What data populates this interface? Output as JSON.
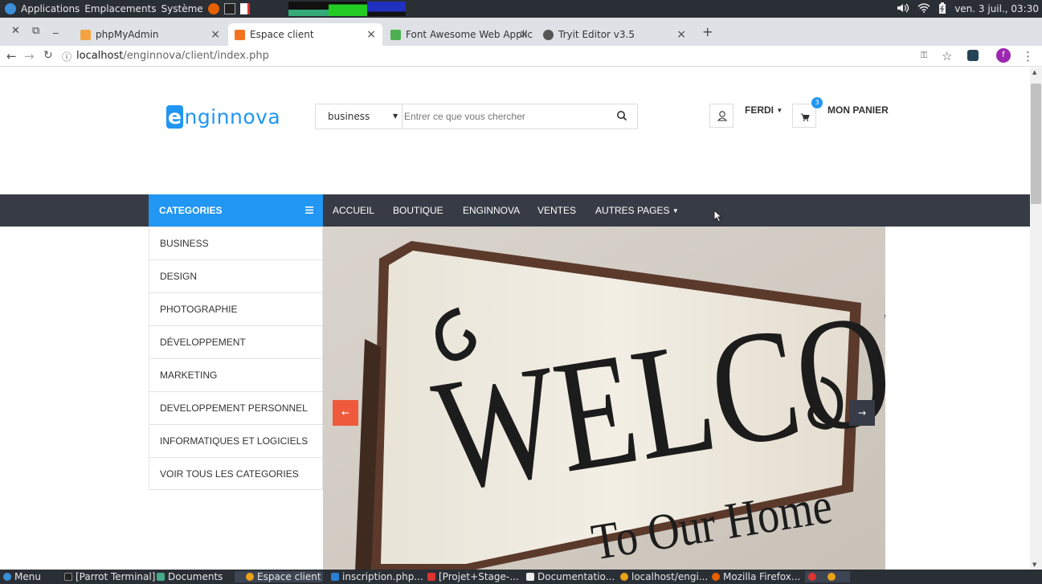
{
  "os_panel": {
    "menus": [
      "Applications",
      "Emplacements",
      "Système"
    ],
    "clock": "ven. 3 juil., 03:30"
  },
  "browser": {
    "tabs": [
      {
        "title": "phpMyAdmin",
        "active": false
      },
      {
        "title": "Espace client",
        "active": true
      },
      {
        "title": "Font Awesome Web Applic",
        "active": false
      },
      {
        "title": "Tryit Editor v3.5",
        "active": false
      }
    ],
    "url_host": "localhost",
    "url_path": "/enginnova/client/index.php",
    "profile_initial": "f"
  },
  "site": {
    "logo": {
      "first": "e",
      "rest": "nginnova"
    },
    "search": {
      "category": "business",
      "placeholder": "Entrer ce que vous chercher"
    },
    "user_label": "FERDI",
    "cart_count": "3",
    "cart_label": "MON PANIER",
    "categories_label": "CATEGORIES",
    "nav": [
      "ACCUEIL",
      "BOUTIQUE",
      "ENGINNOVA",
      "VENTES",
      "AUTRES PAGES"
    ],
    "categories": [
      "BUSINESS",
      "DESIGN",
      "PHOTOGRAPHIE",
      "DÉVELOPPEMENT",
      "MARKETING",
      "DEVELOPPEMENT PERSONNEL",
      "INFORMATIQUES ET LOGICIELS",
      "VOIR TOUS LES CATEGORIES"
    ],
    "slider": {
      "line1": "WELCOME",
      "line2": "To Our Home",
      "prev": "←",
      "next": "→"
    }
  },
  "taskbar": {
    "menu": "Menu",
    "items": [
      "[Parrot Terminal]",
      "Documents",
      "Espace client - ...",
      "inscription.php...",
      "[Projet+Stage-...",
      "Documentatio...",
      "localhost/engi...",
      "Mozilla Firefox..."
    ]
  },
  "colors": {
    "accent": "#2196f3",
    "navbar": "#363b45",
    "slider_arrow_prev": "#ee5a3b",
    "slider_arrow_next": "#363b45"
  }
}
